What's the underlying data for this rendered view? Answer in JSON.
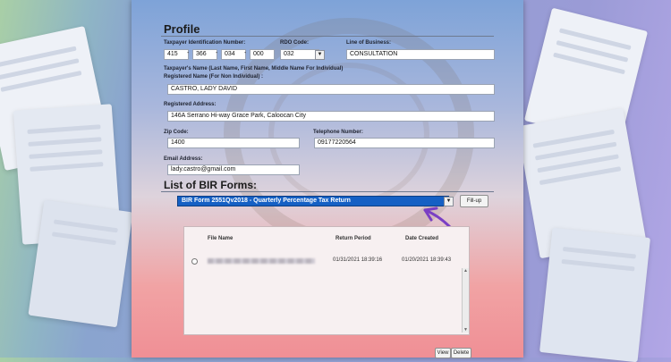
{
  "profile": {
    "title": "Profile",
    "tin_label": "Taxpayer Identification Number:",
    "tin": [
      "415",
      "366",
      "034",
      "000"
    ],
    "rdo_label": "RDO Code:",
    "rdo": "032",
    "line_label": "Line of Business:",
    "line": "CONSULTATION",
    "name_label_1": "Taxpayer's Name (Last Name, First Name, Middle Name For Individual)",
    "name_label_2": "Registered Name (For Non Individual) :",
    "name": "CASTRO, LADY DAVID",
    "address_label": "Registered Address:",
    "address": "146A Serrano Hi-way Grace Park, Caloocan City",
    "zip_label": "Zip Code:",
    "zip": "1400",
    "phone_label": "Telephone Number:",
    "phone": "09177220564",
    "email_label": "Email Address:",
    "email": "lady.castro@gmail.com"
  },
  "forms": {
    "title": "List of BIR Forms:",
    "selected": "BIR Form 2551Qv2018 - Quarterly Percentage Tax Return",
    "fillup_label": "Fill-up",
    "columns": [
      "File Name",
      "Return Period",
      "Date Created"
    ],
    "rows": [
      {
        "return_period": "01/31/2021 18:39:16",
        "date_created": "01/20/2021 18:39:43"
      }
    ],
    "view_label": "View",
    "delete_label": "Delete"
  },
  "colors": {
    "select_bg": "#1560c4",
    "arrow": "#7a3fc4"
  }
}
